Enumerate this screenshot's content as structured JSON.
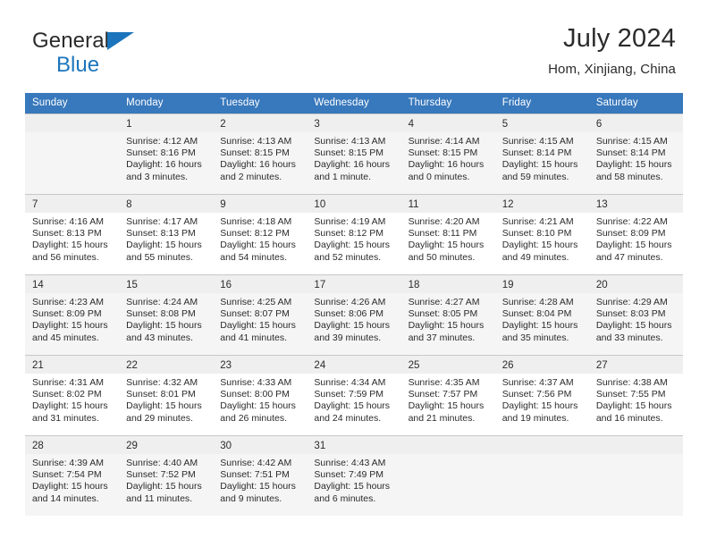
{
  "brand": {
    "line1": "General",
    "line2": "Blue",
    "triangle_icon": "triangle-icon",
    "accent_color": "#1c75bc"
  },
  "header": {
    "title": "July 2024",
    "subtitle": "Hom, Xinjiang, China"
  },
  "calendar": {
    "header_bg": "#3878bc",
    "weekdays": [
      "Sunday",
      "Monday",
      "Tuesday",
      "Wednesday",
      "Thursday",
      "Friday",
      "Saturday"
    ],
    "weeks": [
      [
        {
          "day": "",
          "info": "",
          "blank": true
        },
        {
          "day": "1",
          "info": "Sunrise: 4:12 AM\nSunset: 8:16 PM\nDaylight: 16 hours\nand 3 minutes."
        },
        {
          "day": "2",
          "info": "Sunrise: 4:13 AM\nSunset: 8:15 PM\nDaylight: 16 hours\nand 2 minutes."
        },
        {
          "day": "3",
          "info": "Sunrise: 4:13 AM\nSunset: 8:15 PM\nDaylight: 16 hours\nand 1 minute."
        },
        {
          "day": "4",
          "info": "Sunrise: 4:14 AM\nSunset: 8:15 PM\nDaylight: 16 hours\nand 0 minutes."
        },
        {
          "day": "5",
          "info": "Sunrise: 4:15 AM\nSunset: 8:14 PM\nDaylight: 15 hours\nand 59 minutes."
        },
        {
          "day": "6",
          "info": "Sunrise: 4:15 AM\nSunset: 8:14 PM\nDaylight: 15 hours\nand 58 minutes."
        }
      ],
      [
        {
          "day": "7",
          "info": "Sunrise: 4:16 AM\nSunset: 8:13 PM\nDaylight: 15 hours\nand 56 minutes."
        },
        {
          "day": "8",
          "info": "Sunrise: 4:17 AM\nSunset: 8:13 PM\nDaylight: 15 hours\nand 55 minutes."
        },
        {
          "day": "9",
          "info": "Sunrise: 4:18 AM\nSunset: 8:12 PM\nDaylight: 15 hours\nand 54 minutes."
        },
        {
          "day": "10",
          "info": "Sunrise: 4:19 AM\nSunset: 8:12 PM\nDaylight: 15 hours\nand 52 minutes."
        },
        {
          "day": "11",
          "info": "Sunrise: 4:20 AM\nSunset: 8:11 PM\nDaylight: 15 hours\nand 50 minutes."
        },
        {
          "day": "12",
          "info": "Sunrise: 4:21 AM\nSunset: 8:10 PM\nDaylight: 15 hours\nand 49 minutes."
        },
        {
          "day": "13",
          "info": "Sunrise: 4:22 AM\nSunset: 8:09 PM\nDaylight: 15 hours\nand 47 minutes."
        }
      ],
      [
        {
          "day": "14",
          "info": "Sunrise: 4:23 AM\nSunset: 8:09 PM\nDaylight: 15 hours\nand 45 minutes."
        },
        {
          "day": "15",
          "info": "Sunrise: 4:24 AM\nSunset: 8:08 PM\nDaylight: 15 hours\nand 43 minutes."
        },
        {
          "day": "16",
          "info": "Sunrise: 4:25 AM\nSunset: 8:07 PM\nDaylight: 15 hours\nand 41 minutes."
        },
        {
          "day": "17",
          "info": "Sunrise: 4:26 AM\nSunset: 8:06 PM\nDaylight: 15 hours\nand 39 minutes."
        },
        {
          "day": "18",
          "info": "Sunrise: 4:27 AM\nSunset: 8:05 PM\nDaylight: 15 hours\nand 37 minutes."
        },
        {
          "day": "19",
          "info": "Sunrise: 4:28 AM\nSunset: 8:04 PM\nDaylight: 15 hours\nand 35 minutes."
        },
        {
          "day": "20",
          "info": "Sunrise: 4:29 AM\nSunset: 8:03 PM\nDaylight: 15 hours\nand 33 minutes."
        }
      ],
      [
        {
          "day": "21",
          "info": "Sunrise: 4:31 AM\nSunset: 8:02 PM\nDaylight: 15 hours\nand 31 minutes."
        },
        {
          "day": "22",
          "info": "Sunrise: 4:32 AM\nSunset: 8:01 PM\nDaylight: 15 hours\nand 29 minutes."
        },
        {
          "day": "23",
          "info": "Sunrise: 4:33 AM\nSunset: 8:00 PM\nDaylight: 15 hours\nand 26 minutes."
        },
        {
          "day": "24",
          "info": "Sunrise: 4:34 AM\nSunset: 7:59 PM\nDaylight: 15 hours\nand 24 minutes."
        },
        {
          "day": "25",
          "info": "Sunrise: 4:35 AM\nSunset: 7:57 PM\nDaylight: 15 hours\nand 21 minutes."
        },
        {
          "day": "26",
          "info": "Sunrise: 4:37 AM\nSunset: 7:56 PM\nDaylight: 15 hours\nand 19 minutes."
        },
        {
          "day": "27",
          "info": "Sunrise: 4:38 AM\nSunset: 7:55 PM\nDaylight: 15 hours\nand 16 minutes."
        }
      ],
      [
        {
          "day": "28",
          "info": "Sunrise: 4:39 AM\nSunset: 7:54 PM\nDaylight: 15 hours\nand 14 minutes."
        },
        {
          "day": "29",
          "info": "Sunrise: 4:40 AM\nSunset: 7:52 PM\nDaylight: 15 hours\nand 11 minutes."
        },
        {
          "day": "30",
          "info": "Sunrise: 4:42 AM\nSunset: 7:51 PM\nDaylight: 15 hours\nand 9 minutes."
        },
        {
          "day": "31",
          "info": "Sunrise: 4:43 AM\nSunset: 7:49 PM\nDaylight: 15 hours\nand 6 minutes."
        },
        {
          "day": "",
          "info": "",
          "blank": true
        },
        {
          "day": "",
          "info": "",
          "blank": true
        },
        {
          "day": "",
          "info": "",
          "blank": true
        }
      ]
    ]
  }
}
